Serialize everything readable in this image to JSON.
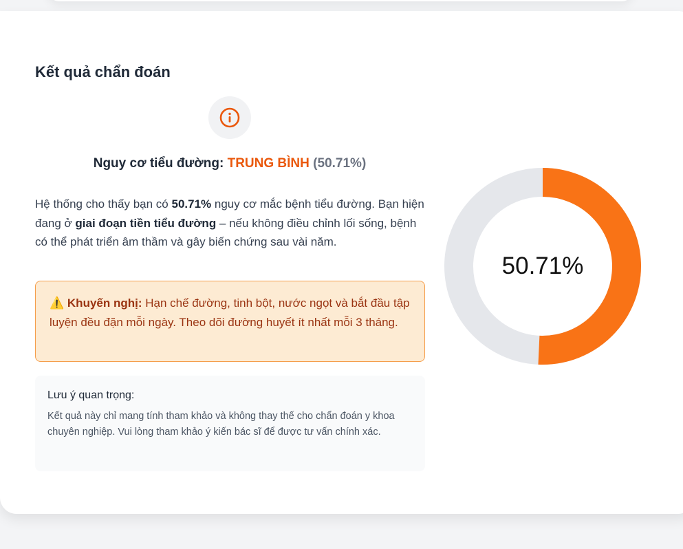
{
  "diagnosis": {
    "title": "Kết quả chẩn đoán",
    "risk": {
      "prefix": "Nguy cơ tiểu đường:",
      "level": "TRUNG BÌNH",
      "percent_text": "(50.71%)"
    },
    "description": {
      "part1": "Hệ thống cho thấy bạn có ",
      "bold1": "50.71%",
      "part2": " nguy cơ mắc bệnh tiểu đường. Bạn hiện đang ở ",
      "bold2": "giai đoạn tiền tiểu đường",
      "part3": " – nếu không điều chỉnh lối sống, bệnh có thể phát triển âm thầm và gây biến chứng sau vài năm."
    },
    "advice": {
      "label": "Khuyến nghị:",
      "text": " Hạn chế đường, tinh bột, nước ngọt và bắt đầu tập luyện đều đặn mỗi ngày. Theo dõi đường huyết ít nhất mỗi 3 tháng."
    },
    "note": {
      "title": "Lưu ý quan trọng:",
      "text": "Kết quả này chỉ mang tính tham khảo và không thay thế cho chẩn đoán y khoa chuyên nghiệp. Vui lòng tham khảo ý kiến bác sĩ để được tư vấn chính xác."
    }
  },
  "icons": {
    "info": "info-circle-icon",
    "warning": "warning-icon"
  },
  "colors": {
    "accent": "#ea580c",
    "donut_fill": "#f97316",
    "donut_track": "#e5e7eb",
    "advice_bg": "#fdebd3",
    "advice_border": "#f59e4b",
    "advice_text": "#9a3412"
  },
  "chart_data": {
    "type": "pie",
    "style": "donut",
    "value": 50.71,
    "max": 100,
    "center_label": "50.71%"
  }
}
